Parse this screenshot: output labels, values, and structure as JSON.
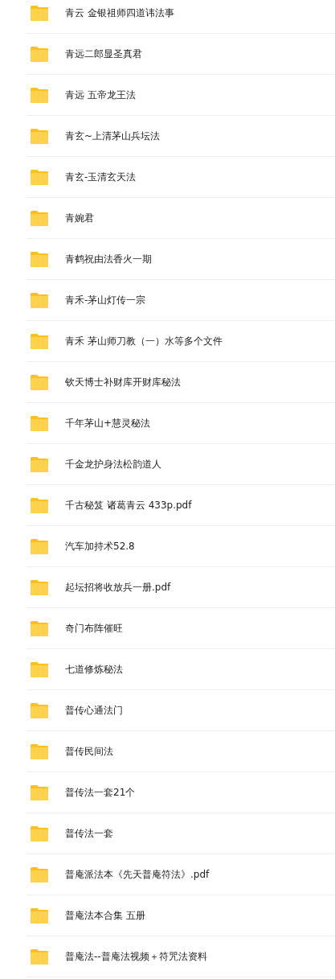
{
  "folders": [
    {
      "name": "青云 金银祖师四道讳法事"
    },
    {
      "name": "青远二郎显圣真君"
    },
    {
      "name": "青远 五帝龙王法"
    },
    {
      "name": "青玄~上清茅山兵坛法"
    },
    {
      "name": "青玄-玉清玄天法"
    },
    {
      "name": "青婉君"
    },
    {
      "name": "青鹤祝由法香火一期"
    },
    {
      "name": "青禾-茅山灯传一宗"
    },
    {
      "name": "青禾 茅山师刀教（一）水等多个文件"
    },
    {
      "name": "钦天博士补财库开财库秘法"
    },
    {
      "name": "千年茅山+慧灵秘法"
    },
    {
      "name": "千金龙护身法松韵道人"
    },
    {
      "name": "千古秘笈 诸葛青云 433p.pdf"
    },
    {
      "name": "汽车加持术52.8"
    },
    {
      "name": "起坛招将收放兵一册.pdf"
    },
    {
      "name": "奇门布阵催旺"
    },
    {
      "name": "七道修炼秘法"
    },
    {
      "name": "普传心通法门"
    },
    {
      "name": "普传民间法"
    },
    {
      "name": "普传法一套21个"
    },
    {
      "name": "普传法一套"
    },
    {
      "name": "普庵派法本《先天普庵符法》.pdf"
    },
    {
      "name": "普庵法本合集 五册"
    },
    {
      "name": "普庵法--普庵法视频＋符咒法资料"
    }
  ]
}
